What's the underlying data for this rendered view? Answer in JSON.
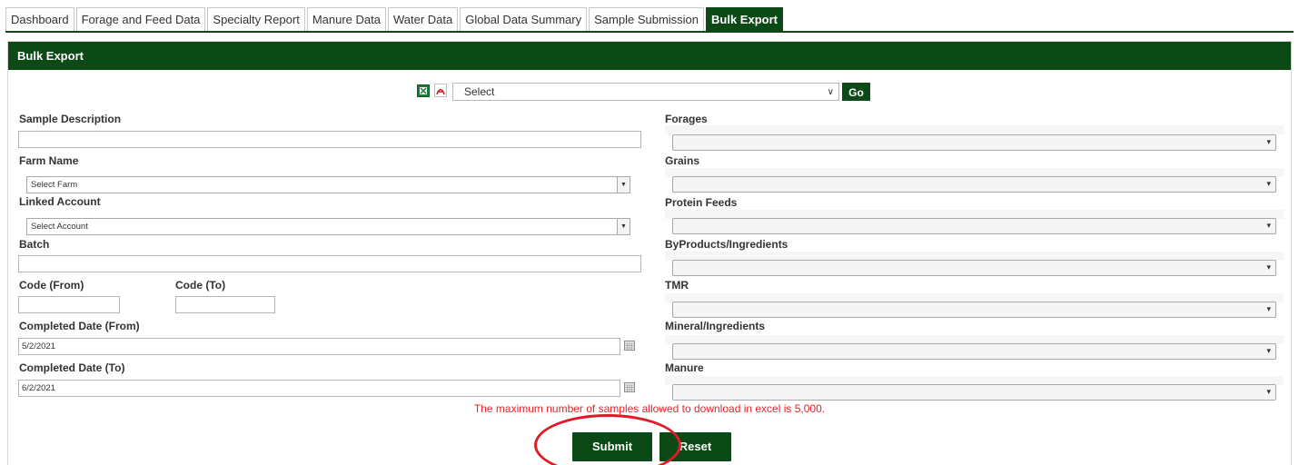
{
  "tabs": [
    {
      "label": "Dashboard"
    },
    {
      "label": "Forage and Feed Data"
    },
    {
      "label": "Specialty Report"
    },
    {
      "label": "Manure Data"
    },
    {
      "label": "Water Data"
    },
    {
      "label": "Global Data Summary"
    },
    {
      "label": "Sample Submission"
    },
    {
      "label": "Bulk Export"
    }
  ],
  "active_tab": "Bulk Export",
  "panel": {
    "title": "Bulk Export"
  },
  "export": {
    "excel_icon": "excel-icon",
    "pdf_icon": "pdf-icon",
    "select_value": "Select",
    "go_label": "Go"
  },
  "left_form": {
    "sample_description_label": "Sample Description",
    "sample_description_value": "",
    "farm_name_label": "Farm Name",
    "farm_name_value": "Select Farm",
    "linked_account_label": "Linked Account",
    "linked_account_value": "Select Account",
    "batch_label": "Batch",
    "batch_value": "",
    "code_from_label": "Code (From)",
    "code_to_label": "Code (To)",
    "completed_from_label": "Completed Date (From)",
    "completed_from_value": "5/2/2021",
    "completed_to_label": "Completed Date (To)",
    "completed_to_value": "6/2/2021"
  },
  "right_form": {
    "categories": [
      {
        "label": "Forages",
        "value": ""
      },
      {
        "label": "Grains",
        "value": ""
      },
      {
        "label": "Protein Feeds",
        "value": ""
      },
      {
        "label": "ByProducts/Ingredients",
        "value": ""
      },
      {
        "label": "TMR",
        "value": ""
      },
      {
        "label": "Mineral/Ingredients",
        "value": ""
      },
      {
        "label": "Manure",
        "value": ""
      }
    ]
  },
  "warning": "The maximum number of samples allowed to download in excel is 5,000.",
  "buttons": {
    "submit_label": "Submit",
    "reset_label": "Reset"
  },
  "colors": {
    "brand_green": "#0b4a17",
    "warning_red": "#e0262a",
    "annotation_red": "#e01b25"
  }
}
